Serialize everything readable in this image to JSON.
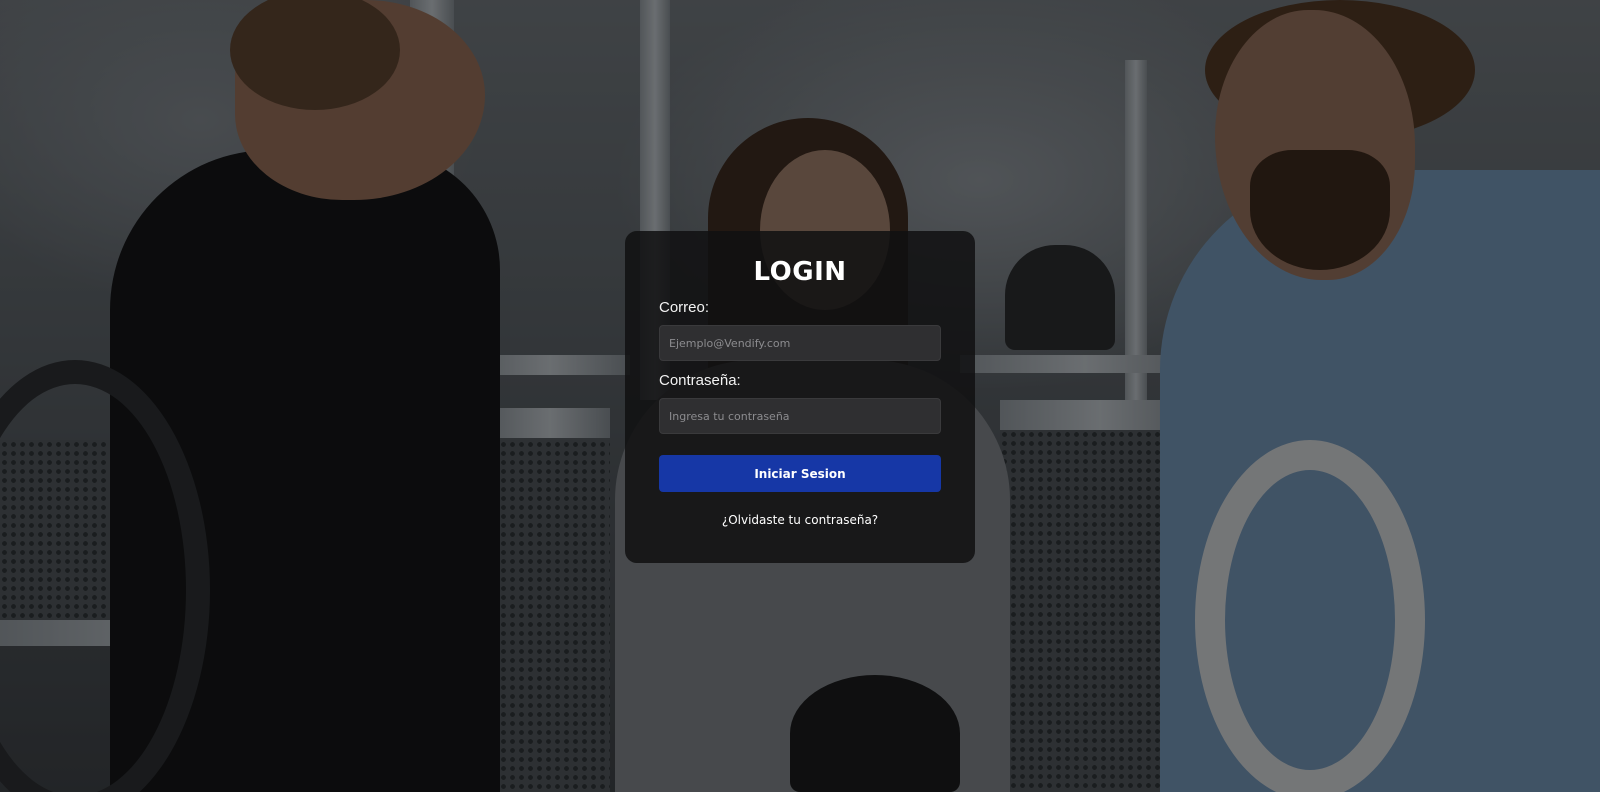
{
  "background": {
    "description_icon": "photo-lab-background",
    "overlay_color": "#000000"
  },
  "login": {
    "title": "LOGIN",
    "email_label": "Correo:",
    "email_placeholder": "Ejemplo@Vendify.com",
    "email_value": "",
    "password_label": "Contraseña:",
    "password_placeholder": "Ingresa tu contraseña",
    "password_value": "",
    "submit_label": "Iniciar Sesion",
    "forgot_label": "¿Olvidaste tu contraseña?",
    "card_color": "#101011",
    "button_color": "#1637a6"
  }
}
